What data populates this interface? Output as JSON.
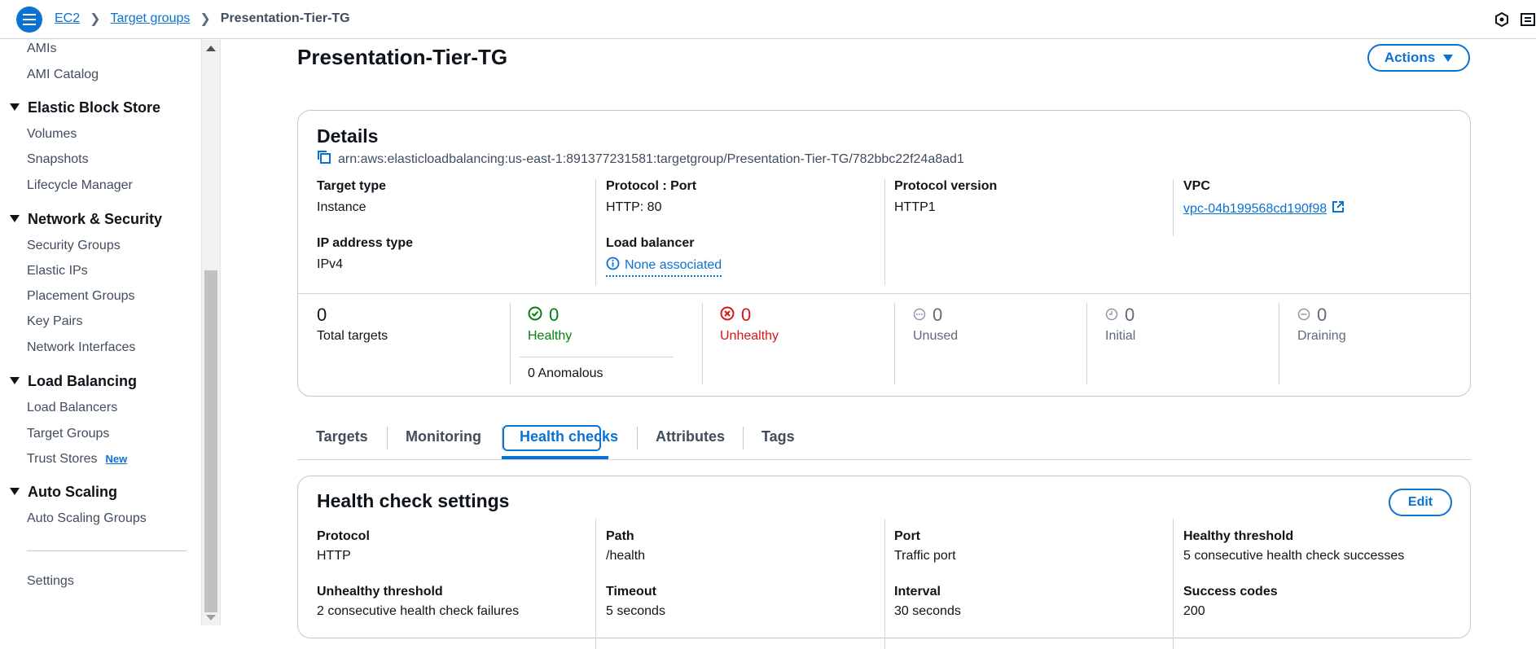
{
  "breadcrumb": {
    "items": [
      "EC2",
      "Target groups"
    ],
    "current": "Presentation-Tier-TG"
  },
  "sidebar": {
    "top_items": [
      "AMIs",
      "AMI Catalog"
    ],
    "sections": [
      {
        "title": "Elastic Block Store",
        "items": [
          "Volumes",
          "Snapshots",
          "Lifecycle Manager"
        ]
      },
      {
        "title": "Network & Security",
        "items": [
          "Security Groups",
          "Elastic IPs",
          "Placement Groups",
          "Key Pairs",
          "Network Interfaces"
        ]
      },
      {
        "title": "Load Balancing",
        "items": [
          "Load Balancers",
          "Target Groups",
          "Trust Stores"
        ]
      },
      {
        "title": "Auto Scaling",
        "items": [
          "Auto Scaling Groups"
        ]
      }
    ],
    "trust_stores_badge": "New",
    "settings": "Settings"
  },
  "page": {
    "title": "Presentation-Tier-TG",
    "actions_label": "Actions"
  },
  "details": {
    "title": "Details",
    "arn": "arn:aws:elasticloadbalancing:us-east-1:891377231581:targetgroup/Presentation-Tier-TG/782bbc22f24a8ad1",
    "target_type": {
      "label": "Target type",
      "value": "Instance"
    },
    "protocol_port": {
      "label": "Protocol : Port",
      "value": "HTTP: 80"
    },
    "protocol_version": {
      "label": "Protocol version",
      "value": "HTTP1"
    },
    "vpc": {
      "label": "VPC",
      "value": "vpc-04b199568cd190f98"
    },
    "ip_address_type": {
      "label": "IP address type",
      "value": "IPv4"
    },
    "load_balancer": {
      "label": "Load balancer",
      "value": "None associated"
    }
  },
  "stats": {
    "total": {
      "value": "0",
      "label": "Total targets"
    },
    "healthy": {
      "value": "0",
      "label": "Healthy",
      "anomalous": "0 Anomalous"
    },
    "unhealthy": {
      "value": "0",
      "label": "Unhealthy"
    },
    "unused": {
      "value": "0",
      "label": "Unused"
    },
    "initial": {
      "value": "0",
      "label": "Initial"
    },
    "draining": {
      "value": "0",
      "label": "Draining"
    }
  },
  "tabs": [
    "Targets",
    "Monitoring",
    "Health checks",
    "Attributes",
    "Tags"
  ],
  "health_check": {
    "title": "Health check settings",
    "edit_label": "Edit",
    "protocol": {
      "label": "Protocol",
      "value": "HTTP"
    },
    "path": {
      "label": "Path",
      "value": "/health"
    },
    "port": {
      "label": "Port",
      "value": "Traffic port"
    },
    "healthy_threshold": {
      "label": "Healthy threshold",
      "value": "5 consecutive health check successes"
    },
    "unhealthy_threshold": {
      "label": "Unhealthy threshold",
      "value": "2 consecutive health check failures"
    },
    "timeout": {
      "label": "Timeout",
      "value": "5 seconds"
    },
    "interval": {
      "label": "Interval",
      "value": "30 seconds"
    },
    "success_codes": {
      "label": "Success codes",
      "value": "200"
    }
  },
  "colors": {
    "accent": "#0972d3",
    "success": "#037f0c",
    "error": "#d91515",
    "muted": "#5f6b7a"
  }
}
